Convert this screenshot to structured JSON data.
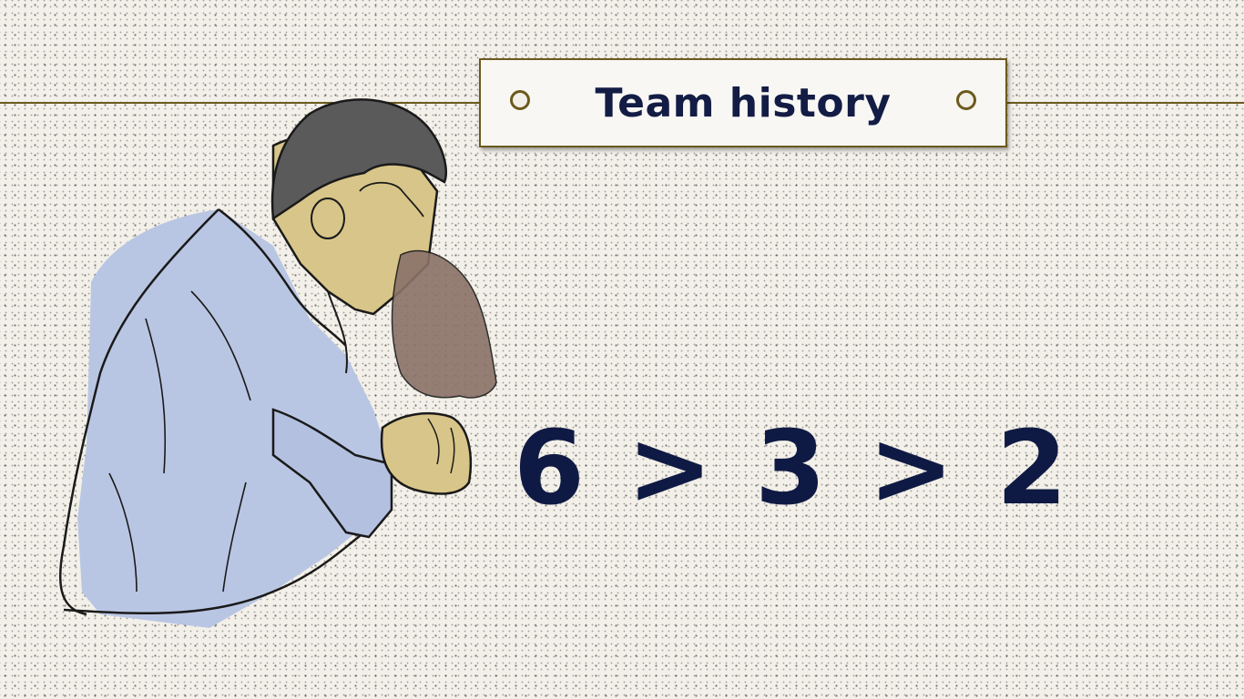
{
  "title": "Team history",
  "sequence": {
    "first": "6",
    "op1": ">",
    "second": "3",
    "op2": ">",
    "third": "2"
  },
  "colors": {
    "background": "#f3f0e9",
    "title_text": "#131c44",
    "numbers": "#0f1a44",
    "string_line": "#6b5a1e",
    "shirt": "#b9c6e3",
    "skin": "#d8c589",
    "hair": "#5a5a5a",
    "clay": "#8a7268"
  },
  "illustration": {
    "subject": "thinking-man-sketch",
    "icon": "person-icon"
  }
}
